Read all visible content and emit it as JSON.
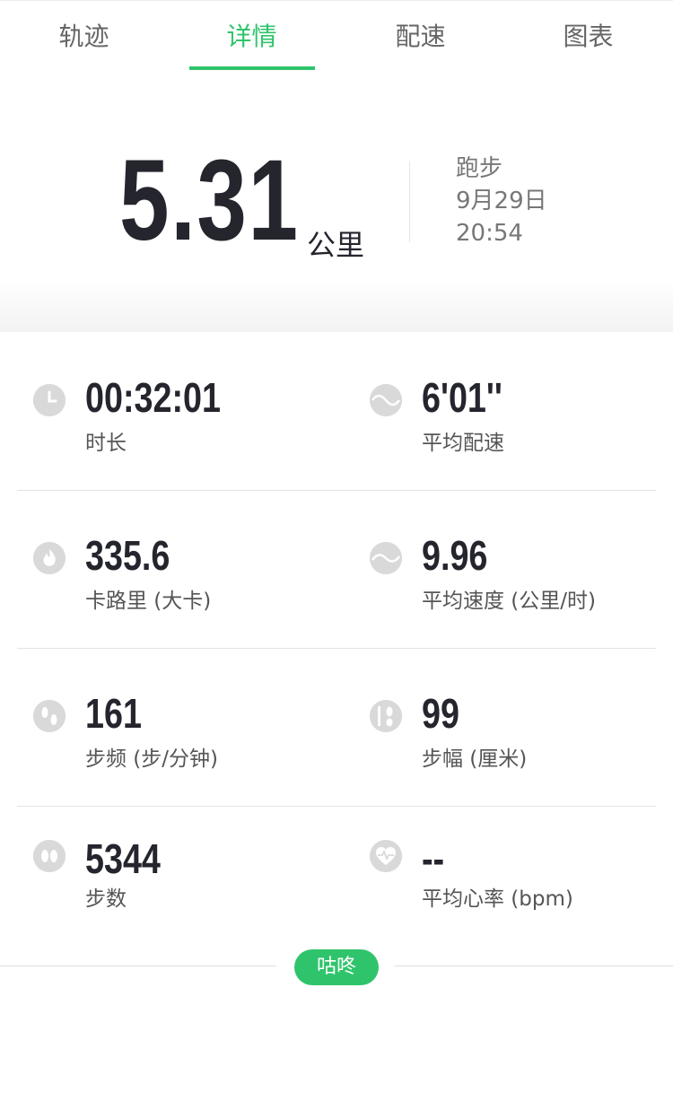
{
  "tabs": [
    "轨迹",
    "详情",
    "配速",
    "图表"
  ],
  "active_tab_index": 1,
  "accent_color": "#2fc46b",
  "summary": {
    "distance": "5.31",
    "distance_unit": "公里",
    "activity_type": "跑步",
    "date": "9月29日",
    "time": "20:54"
  },
  "stats": [
    {
      "icon": "clock-icon",
      "value": "00:32:01",
      "label": "时长"
    },
    {
      "icon": "pace-wave-icon",
      "value": "6'01''",
      "label": "平均配速"
    },
    {
      "icon": "flame-icon",
      "value": "335.6",
      "label": "卡路里 (大卡)"
    },
    {
      "icon": "speed-wave-icon",
      "value": "9.96",
      "label": "平均速度 (公里/时)"
    },
    {
      "icon": "cadence-feet-icon",
      "value": "161",
      "label": "步频 (步/分钟)"
    },
    {
      "icon": "stride-ruler-icon",
      "value": "99",
      "label": "步幅 (厘米)"
    },
    {
      "icon": "footsteps-icon",
      "value": "5344",
      "label": "步数"
    },
    {
      "icon": "heart-rate-icon",
      "value": "--",
      "label": "平均心率 (bpm)"
    }
  ],
  "brand_label": "咕咚"
}
